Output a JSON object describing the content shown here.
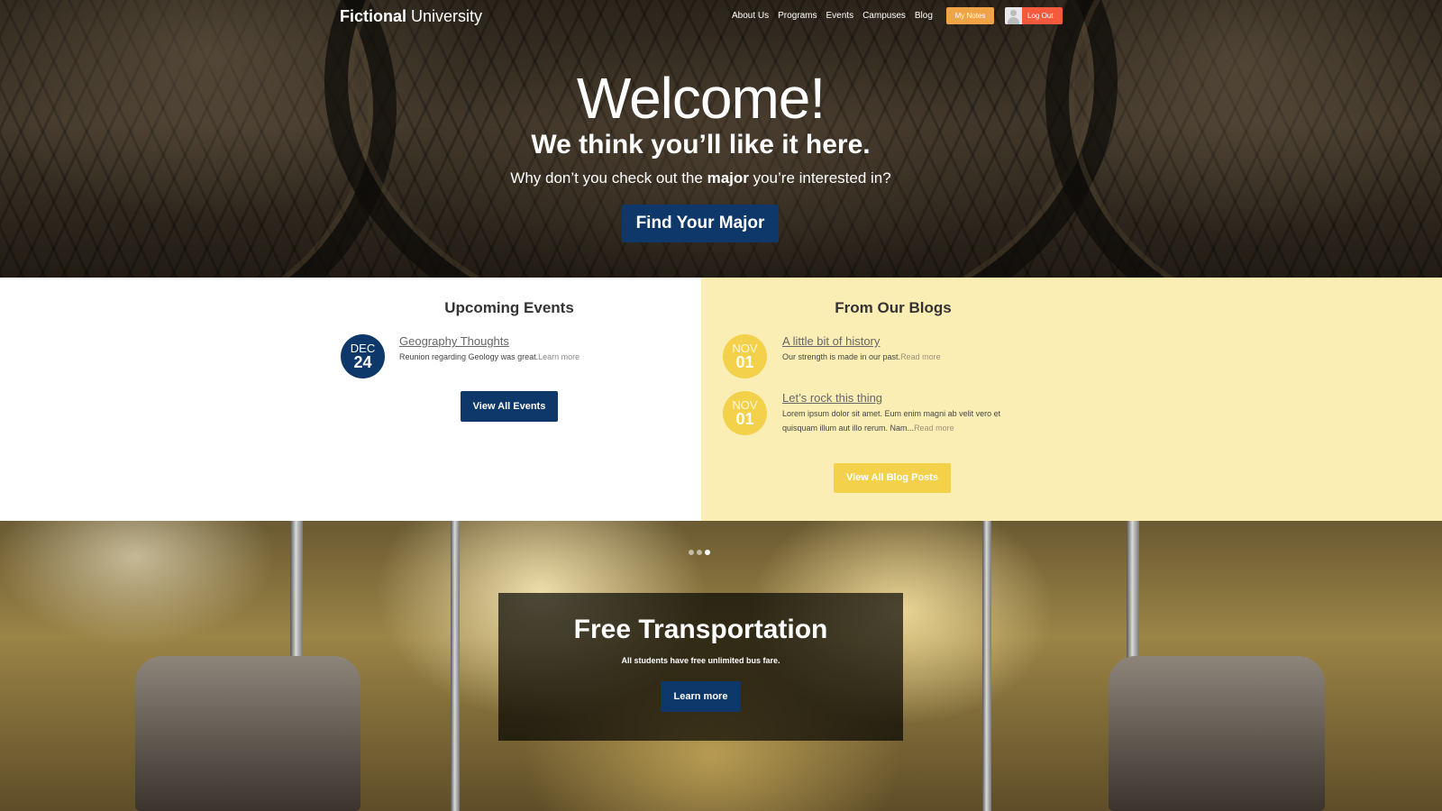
{
  "header": {
    "logo_bold": "Fictional",
    "logo_regular": " University",
    "nav": [
      "About Us",
      "Programs",
      "Events",
      "Campuses",
      "Blog"
    ],
    "my_notes_label": "My Notes",
    "logout_label": "Log Out"
  },
  "hero": {
    "title": "Welcome!",
    "subtitle": "We think you’ll like it here.",
    "question_prefix": "Why don’t you check out the ",
    "question_bold": "major",
    "question_suffix": " you’re interested in?",
    "button_label": "Find Your Major"
  },
  "events": {
    "heading": "Upcoming Events",
    "items": [
      {
        "month": "DEC",
        "day": "24",
        "title": "Geography Thoughts",
        "excerpt": "Reunion regarding Geology was great.",
        "more": "Learn more"
      }
    ],
    "button_label": "View All Events"
  },
  "blogs": {
    "heading": "From Our Blogs",
    "items": [
      {
        "month": "NOV",
        "day": "01",
        "title": "A little bit of history",
        "excerpt": "Our strength is made in our past.",
        "more": "Read more"
      },
      {
        "month": "NOV",
        "day": "01",
        "title": "Let’s rock this thing",
        "excerpt_line1": "Lorem ipsum dolor sit amet. Eum enim magni ab velit vero et",
        "excerpt_line2": "quisquam illum aut illo rerum. Nam...",
        "more": "Read more"
      }
    ],
    "button_label": "View All Blog Posts"
  },
  "slider": {
    "slide_count": 3,
    "active_slide": 3,
    "title": "Free Transportation",
    "text": "All students have free unlimited bus fare.",
    "button_label": "Learn more"
  },
  "colors": {
    "brand_blue": "#0e3869",
    "notes_orange": "#f0a446",
    "logout_red": "#f55a3d",
    "blog_bg": "#fbeeb5",
    "accent_yellow": "#f3d14b"
  }
}
